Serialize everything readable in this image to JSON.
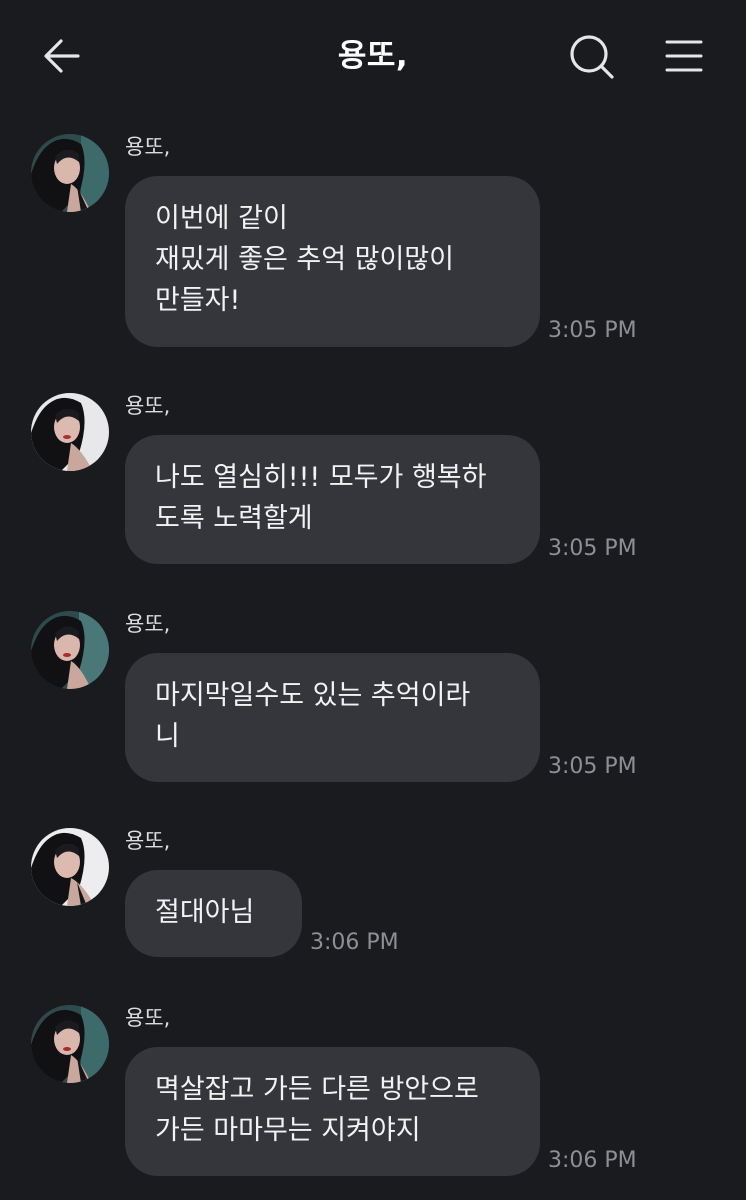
{
  "header": {
    "title": "용또,",
    "back_icon": "arrow-left-icon",
    "search_icon": "search-icon",
    "menu_icon": "hamburger-menu-icon"
  },
  "messages": [
    {
      "sender": "용또,",
      "text": "이번에 같이\n재밌게 좋은 추억 많이많이\n만들자!",
      "time": "3:05 PM"
    },
    {
      "sender": "용또,",
      "text": "나도 열심히!!! 모두가 행복하\n도록 노력할게",
      "time": "3:05 PM"
    },
    {
      "sender": "용또,",
      "text": "마지막일수도 있는 추억이라\n니",
      "time": "3:05 PM"
    },
    {
      "sender": "용또,",
      "text": "절대아님",
      "time": "3:06 PM"
    },
    {
      "sender": "용또,",
      "text": "멱살잡고 가든 다른 방안으로\n가든 마마무는 지켜야지",
      "time": "3:06 PM"
    }
  ],
  "colors": {
    "background": "#1a1b1f",
    "bubble": "#34363c",
    "text": "#f2f2f3",
    "time": "#8e8f95"
  }
}
